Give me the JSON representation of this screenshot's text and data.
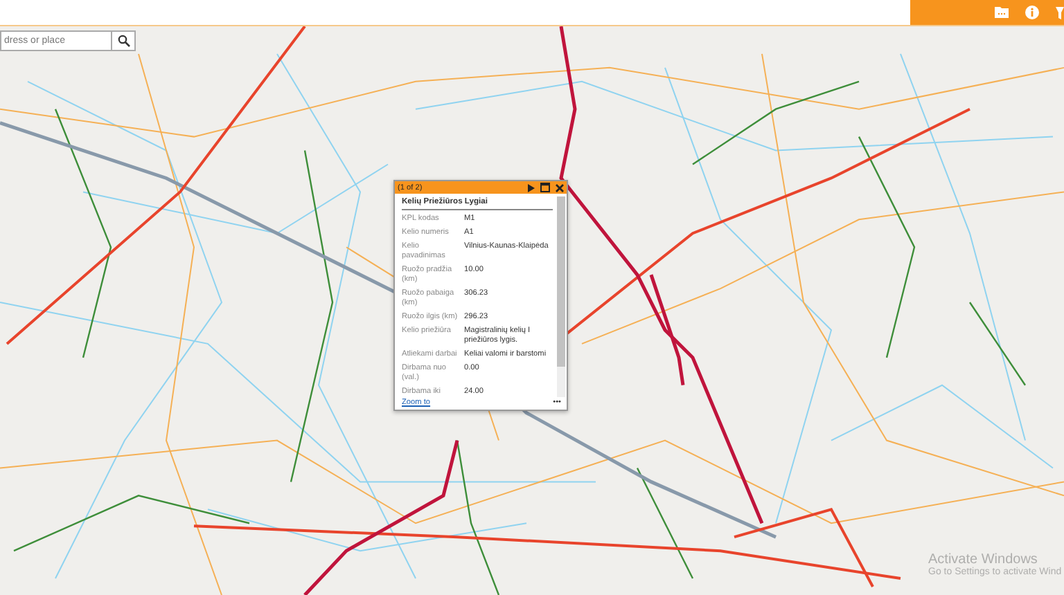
{
  "search": {
    "placeholder": "dress or place"
  },
  "popup": {
    "pager": "(1 of 2)",
    "title": "Kelių Priežiūros Lygiai",
    "fields": [
      {
        "label": "KPL kodas",
        "value": "M1"
      },
      {
        "label": "Kelio numeris",
        "value": "A1"
      },
      {
        "label": "Kelio pavadinimas",
        "value": "Vilnius-Kaunas-Klaipėda"
      },
      {
        "label": "Ruožo pradžia (km)",
        "value": "10.00"
      },
      {
        "label": "Ruožo pabaiga (km)",
        "value": "306.23"
      },
      {
        "label": "Ruožo ilgis (km)",
        "value": "296.23"
      },
      {
        "label": "Kelio priežiūra",
        "value": "Magistralinių kelių I priežiūros lygis."
      },
      {
        "label": "Atliekami darbai",
        "value": "Keliai valomi ir barstomi"
      },
      {
        "label": "Dirbama nuo (val.)",
        "value": "0.00"
      },
      {
        "label": "Dirbama iki",
        "value": "24.00"
      }
    ],
    "link": "Zoom to",
    "more": "•••"
  },
  "os_notice": {
    "title": "Activate Windows",
    "text": "Go to Settings to activate Wind"
  }
}
